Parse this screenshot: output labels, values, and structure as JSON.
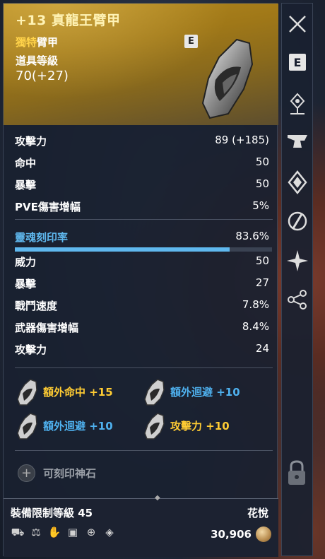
{
  "item": {
    "name": "+13 真龍王臂甲",
    "type_highlight": "獨特",
    "type_rest": "臂甲",
    "level_label": "道具等級",
    "level_value": "70(+27)",
    "badge": "E"
  },
  "stats": [
    {
      "label": "攻擊力",
      "value": "89 (+185)"
    },
    {
      "label": "命中",
      "value": "50"
    },
    {
      "label": "暴擊",
      "value": "50"
    },
    {
      "label": "PVE傷害增幅",
      "value": "5%"
    }
  ],
  "soul": {
    "label": "靈魂刻印率",
    "value": "83.6%",
    "progress": 0.836
  },
  "soul_stats": [
    {
      "label": "威力",
      "value": "50"
    },
    {
      "label": "暴擊",
      "value": "27"
    },
    {
      "label": "戰鬥速度",
      "value": "7.8%"
    },
    {
      "label": "武器傷害增幅",
      "value": "8.4%"
    },
    {
      "label": "攻擊力",
      "value": "24"
    }
  ],
  "extras": [
    {
      "text": "額外命中 +15",
      "color": "gold"
    },
    {
      "text": "額外迴避 +10",
      "color": "blue"
    },
    {
      "text": "額外迴避 +10",
      "color": "blue"
    },
    {
      "text": "攻擊力 +10",
      "color": "gold"
    }
  ],
  "socket": {
    "label": "可刻印神石",
    "icon": "plus-icon"
  },
  "footer": {
    "requirement": "裝備限制等級 45",
    "bind": "花悅",
    "price": "30,906"
  },
  "side_buttons": [
    "close-icon",
    "e-key-icon",
    "teleport-icon",
    "anvil-icon",
    "gem-icon",
    "swap-icon",
    "sparkle-icon",
    "share-icon"
  ],
  "colors": {
    "header_gold": "#a07818",
    "soul_blue": "#5fb8ee",
    "extra_gold": "#ffcc33",
    "extra_blue": "#4fb2f0"
  }
}
